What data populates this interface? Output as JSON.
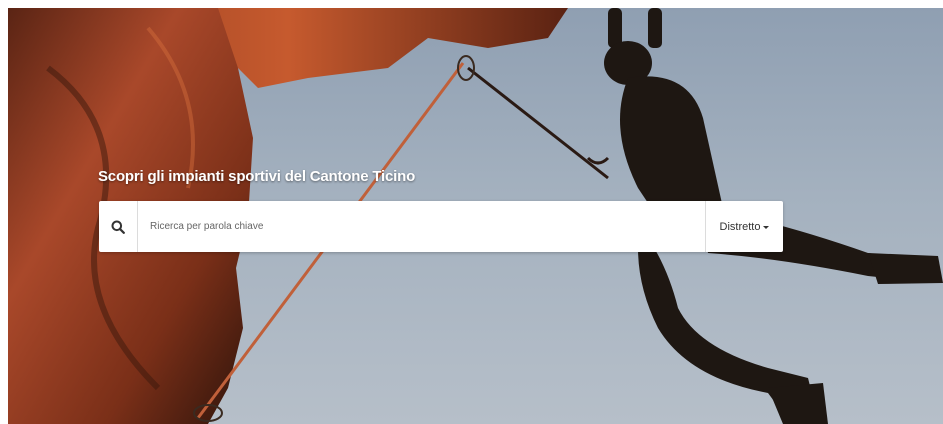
{
  "hero": {
    "headline": "Scopri gli impianti sportivi del Cantone Ticino",
    "image_subject": "climber-on-rock-overhang"
  },
  "search": {
    "placeholder": "Ricerca per parola chiave",
    "value": "",
    "icon": "search-icon"
  },
  "district_dropdown": {
    "label": "Distretto",
    "icon": "caret-down-icon"
  },
  "colors": {
    "sky": "#a4b1bf",
    "rock": "#b0502a",
    "rope": "#c0603a",
    "text_light": "#ffffff",
    "search_background": "#ffffff"
  }
}
